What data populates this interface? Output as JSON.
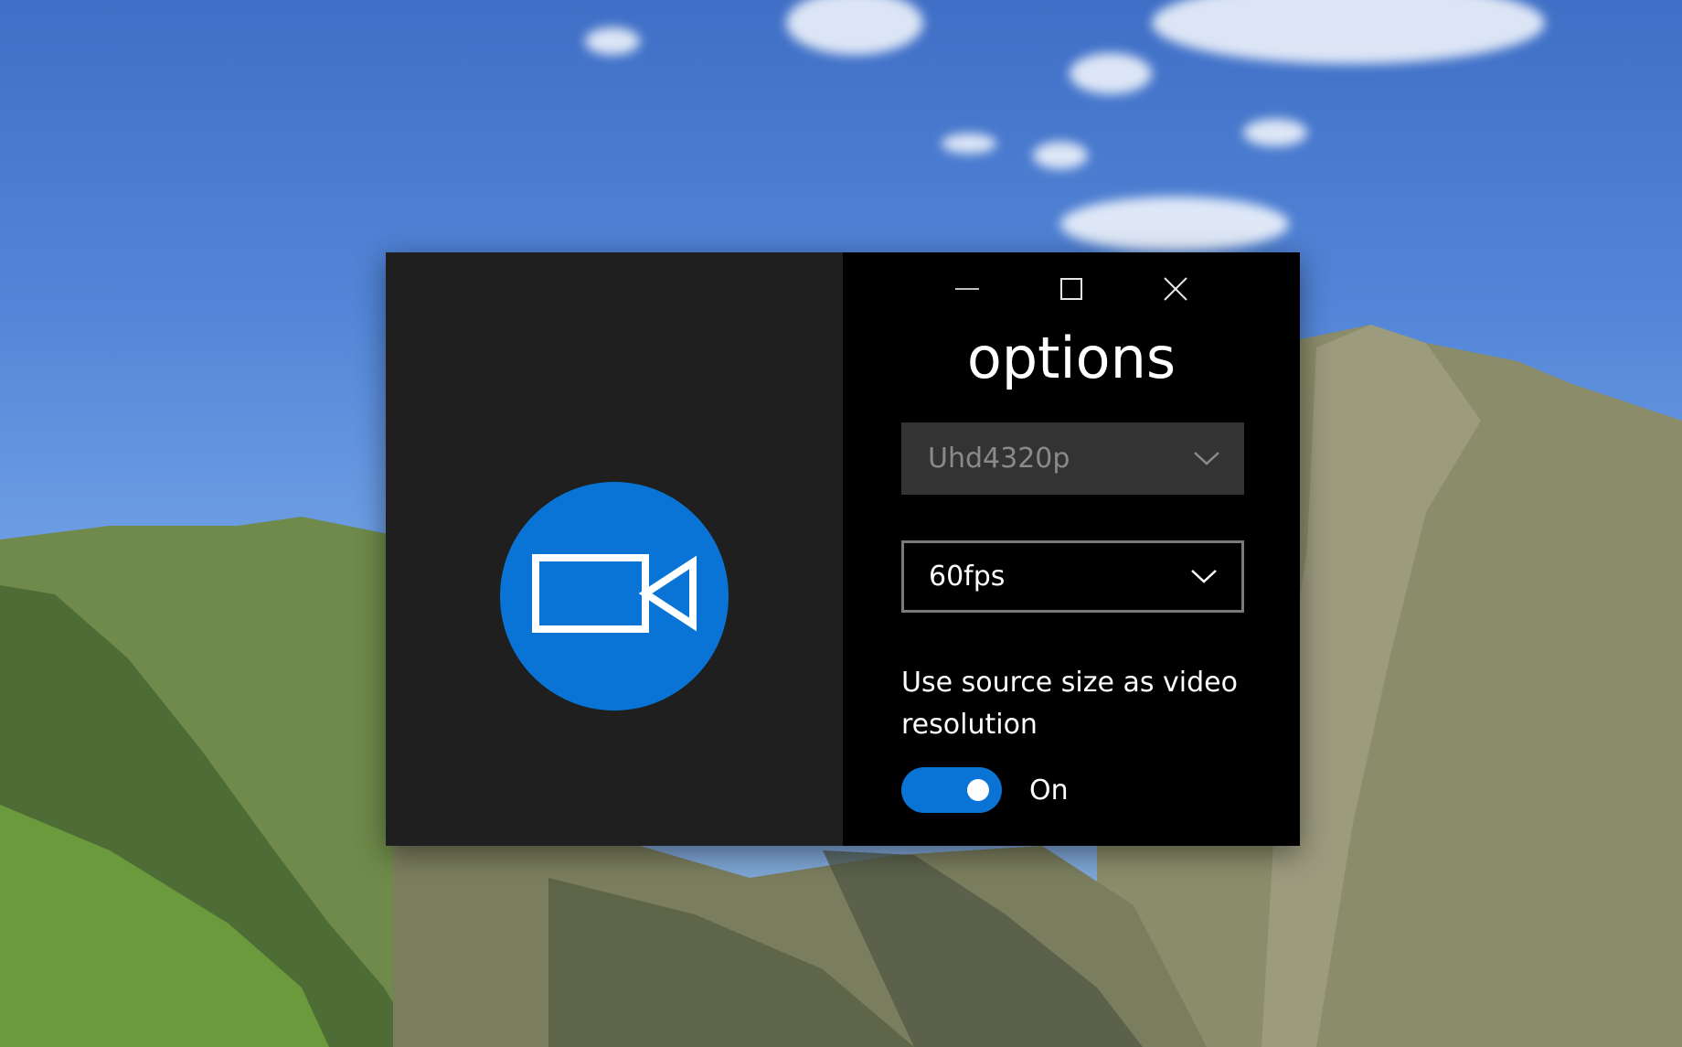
{
  "window": {
    "title": "options",
    "caption_buttons": {
      "minimize_icon": "minimize-icon",
      "maximize_icon": "maximize-icon",
      "close_icon": "close-icon"
    },
    "app_icon": "video-camera-icon",
    "accent_color": "#0a74d6"
  },
  "resolution_combo": {
    "value": "Uhd4320p",
    "enabled": false
  },
  "framerate_combo": {
    "value": "60fps",
    "enabled": true
  },
  "source_size_toggle": {
    "label": "Use source size as video resolution",
    "state_text": "On",
    "is_on": true
  }
}
